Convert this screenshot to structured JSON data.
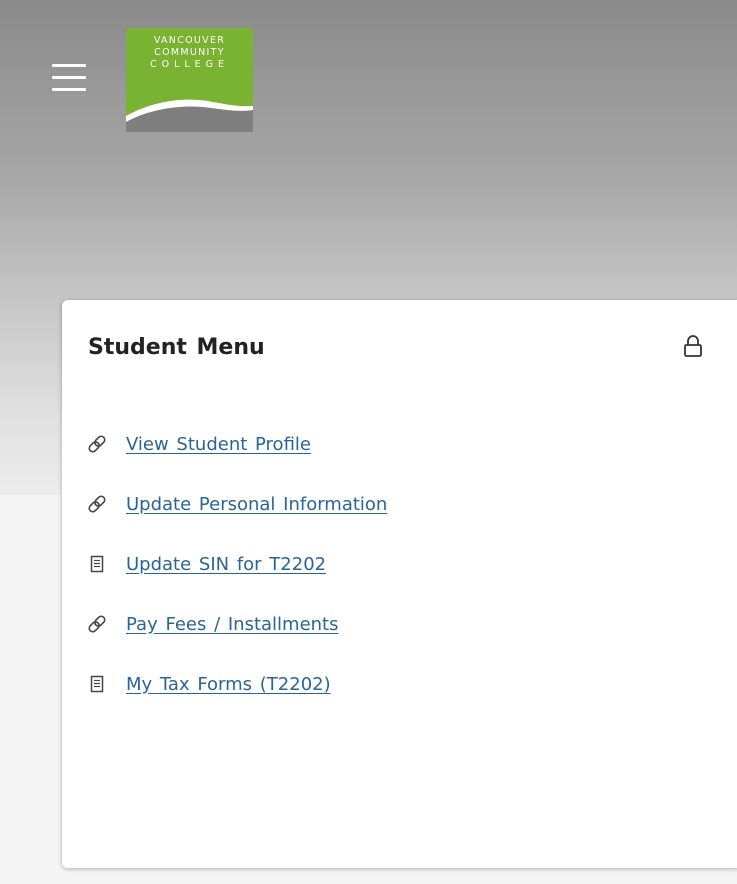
{
  "header": {
    "logo": {
      "line1": "VANCOUVER",
      "line2": "COMMUNITY",
      "line3": "COLLEGE",
      "color": "#7ab231"
    },
    "menu_icon": "hamburger-menu-icon"
  },
  "student_menu": {
    "title": "Student Menu",
    "lock_icon": "lock-icon",
    "items": [
      {
        "label": "View Student Profile",
        "icon": "link-icon"
      },
      {
        "label": "Update Personal Information",
        "icon": "link-icon"
      },
      {
        "label": "Update SIN for T2202",
        "icon": "document-icon"
      },
      {
        "label": "Pay Fees / Installments",
        "icon": "link-icon"
      },
      {
        "label": "My Tax Forms (T2202)",
        "icon": "document-icon"
      }
    ]
  },
  "colors": {
    "link": "#2a6495",
    "brand_green": "#7ab231"
  }
}
